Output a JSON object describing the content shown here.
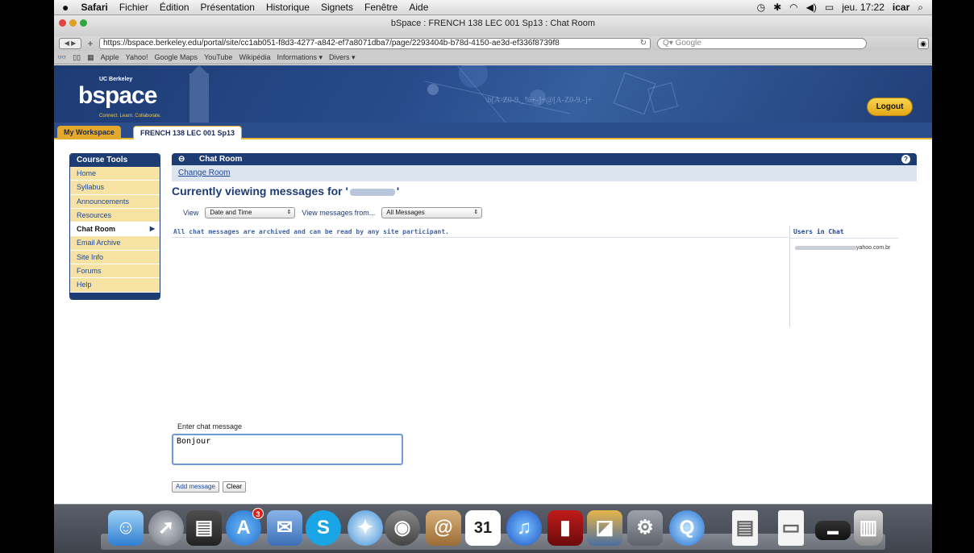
{
  "menubar": {
    "apple": "",
    "app": "Safari",
    "menus": [
      "Fichier",
      "Édition",
      "Présentation",
      "Historique",
      "Signets",
      "Fenêtre",
      "Aide"
    ],
    "datetime": "jeu. 17:22",
    "user": "icar"
  },
  "window": {
    "title": "bSpace : FRENCH 138 LEC 001 Sp13 : Chat Room",
    "url": "https://bspace.berkeley.edu/portal/site/cc1ab051-f8d3-4277-a842-ef7a8071dba7/page/2293404b-b78d-4150-ae3d-ef336f8739f8",
    "search_placeholder": "Google"
  },
  "bookmarks": [
    "Apple",
    "Yahoo!",
    "Google Maps",
    "YouTube",
    "Wikipédia",
    "Informations ▾",
    "Divers ▾"
  ],
  "banner": {
    "ucb": "UC Berkeley",
    "logo": "bspace",
    "tagline": "Connect. Learn. Collaborate.",
    "logout": "Logout"
  },
  "tabs": [
    {
      "label": "My Workspace"
    },
    {
      "label": "FRENCH 138 LEC 001 Sp13"
    }
  ],
  "sidebar": {
    "title": "Course Tools",
    "items": [
      {
        "label": "Home"
      },
      {
        "label": "Syllabus"
      },
      {
        "label": "Announcements"
      },
      {
        "label": "Resources"
      },
      {
        "label": "Chat Room"
      },
      {
        "label": "Email Archive"
      },
      {
        "label": "Site Info"
      },
      {
        "label": "Forums"
      },
      {
        "label": "Help"
      }
    ]
  },
  "chat": {
    "header": "Chat Room",
    "change_room": "Change Room",
    "heading_prefix": "Currently viewing messages for '",
    "heading_suffix": "'",
    "view_label": "View",
    "view_value": "Date and Time",
    "from_label": "View messages from...",
    "from_value": "All Messages",
    "archive_note": "All chat messages are archived and can be read by any site participant.",
    "users_title": "Users in Chat",
    "user_suffix": "yahoo.com.br",
    "enter_label": "Enter chat message",
    "input_value": "Bonjour",
    "add_button": "Add message",
    "clear_button": "Clear"
  },
  "dock": {
    "app_store_badge": "3",
    "calendar_month": "JUIN",
    "calendar_day": "31"
  }
}
